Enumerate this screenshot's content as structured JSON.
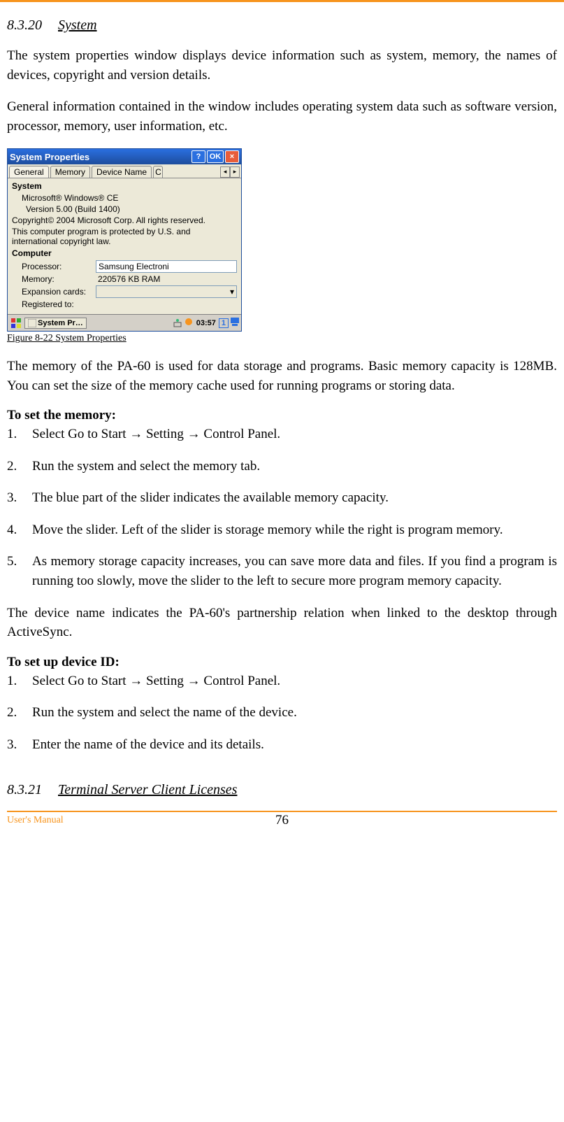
{
  "section1": {
    "num": "8.3.20",
    "title": "System"
  },
  "p1": "The system properties window displays device information such as system, memory, the names of devices, copyright and version details.",
  "p2": "General information contained in the window includes operating system data such as software version, processor, memory, user information, etc.",
  "dialog": {
    "title": "System Properties",
    "help": "?",
    "ok": "OK",
    "close": "×",
    "tabs": [
      "General",
      "Memory",
      "Device Name"
    ],
    "overflow": "C",
    "arrL": "◂",
    "arrR": "▸",
    "group1": "System",
    "sys_line1": "Microsoft® Windows® CE",
    "sys_line2": "Version 5.00 (Build 1400)",
    "sys_line3": "Copyright© 2004 Microsoft Corp. All rights reserved.",
    "sys_line4": "This computer program is protected by U.S. and international copyright law.",
    "group2": "Computer",
    "proc_lbl": "Processor:",
    "proc_val": "Samsung Electroni",
    "mem_lbl": "Memory:",
    "mem_val": "220576 KB  RAM",
    "exp_lbl": "Expansion cards:",
    "reg_lbl": "Registered to:"
  },
  "taskbar": {
    "app": "System Pr…",
    "time": "03:57",
    "kbd": "1"
  },
  "figcap": "Figure 8-22 System Properties",
  "p3": "The memory of the PA-60 is used for data storage and programs. Basic memory capacity is 128MB. You can set the size of the memory cache used for running programs or storing data.",
  "sub1": "To set the memory:",
  "mem_steps": [
    "Select Go to Start  → Setting  → Control Panel.",
    "Run the system and select the memory tab.",
    "The blue part of the slider indicates the available memory capacity.",
    "Move the slider. Left of the slider is storage memory while the right is program memory.",
    "As memory storage capacity increases, you can save more data and files.  If you find a program is running too slowly, move the slider to the left to secure more program memory capacity."
  ],
  "p4": "The device name indicates the PA-60's partnership relation when linked to the desktop through ActiveSync.",
  "sub2": "To set up device ID:",
  "id_steps": [
    "Select Go to Start  → Setting  → Control Panel.",
    "Run the system and select the name of the device.",
    "Enter the name of the device and its details."
  ],
  "section2": {
    "num": "8.3.21",
    "title": "Terminal Server Client Licenses"
  },
  "footer": {
    "left": "User's Manual",
    "page": "76"
  }
}
